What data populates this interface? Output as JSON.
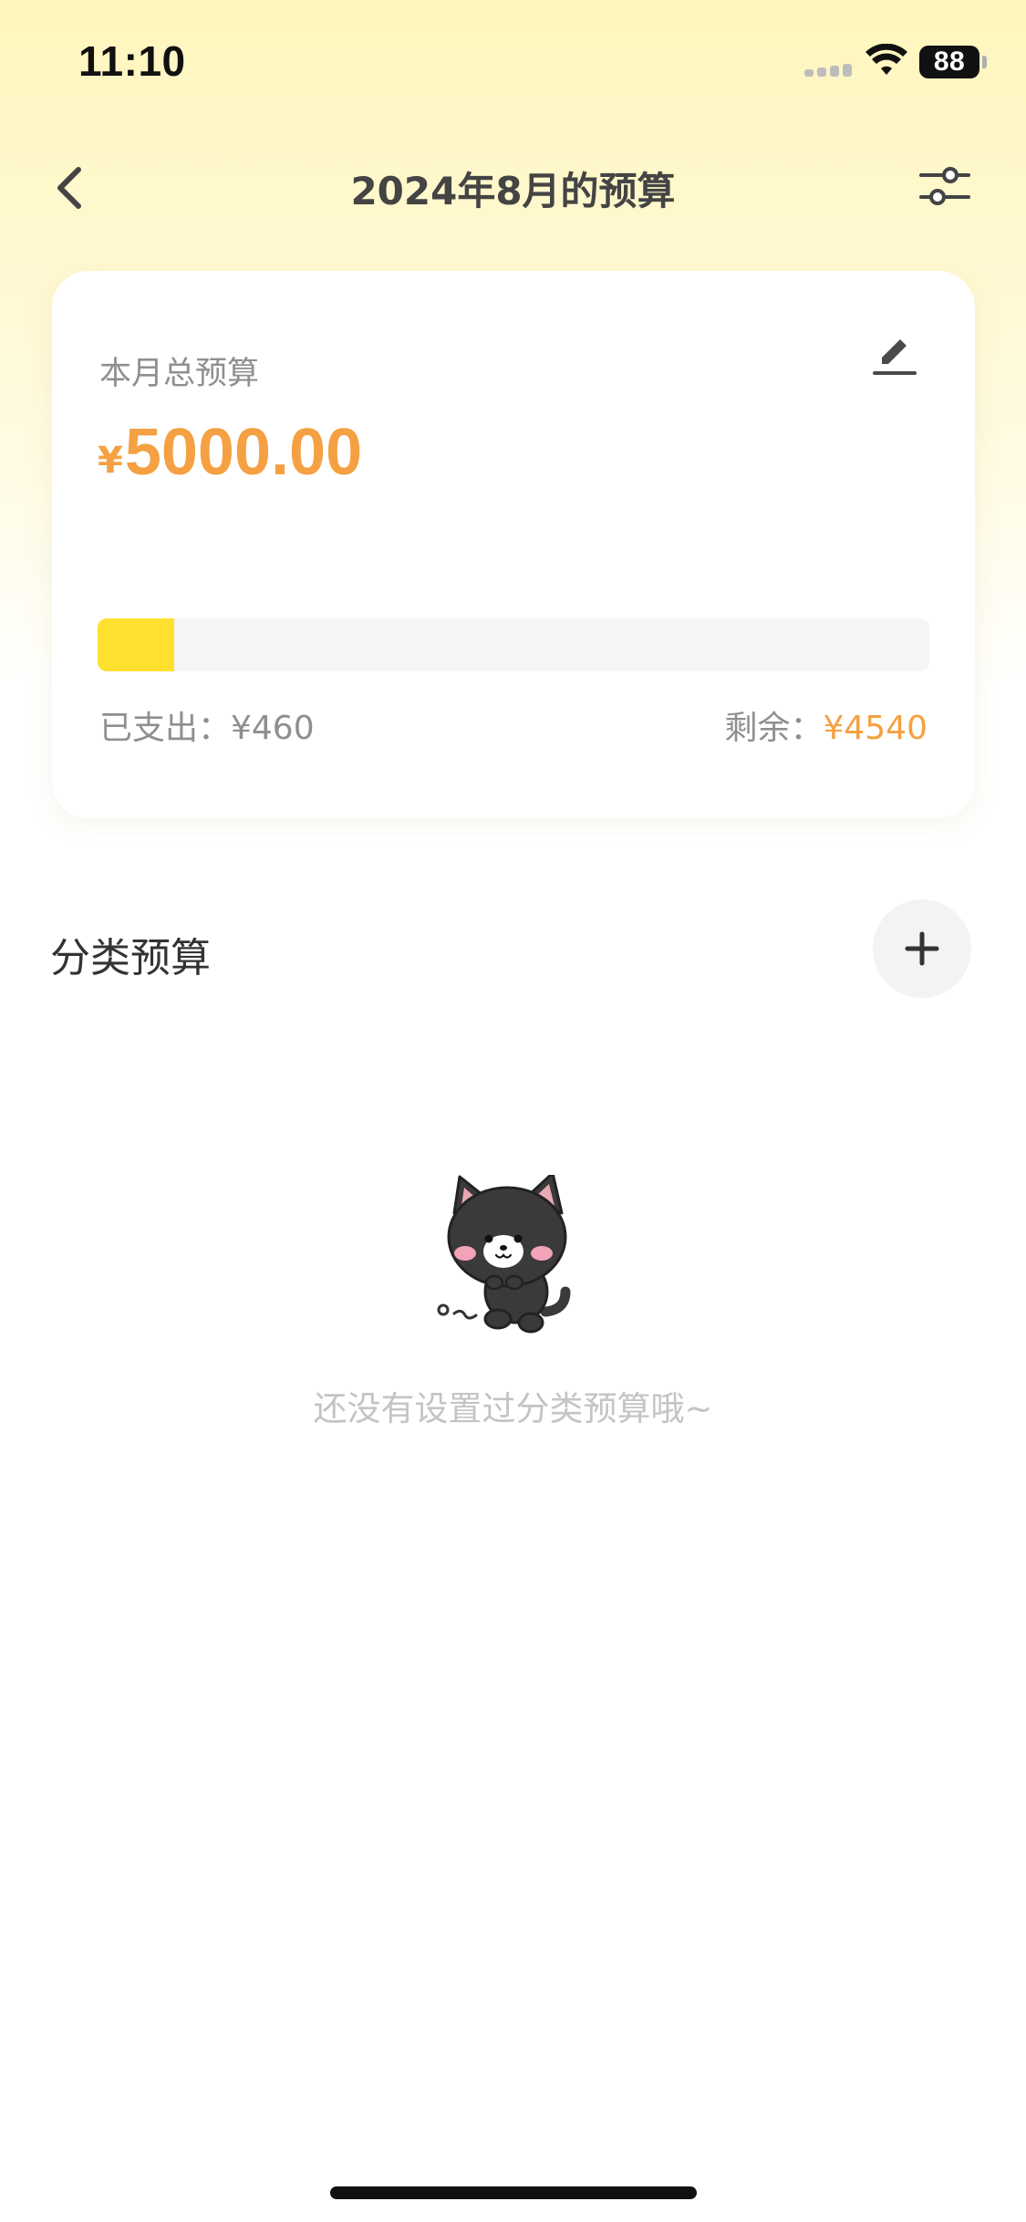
{
  "status_bar": {
    "time": "11:10",
    "battery": "88"
  },
  "nav": {
    "title": "2024年8月的预算",
    "back_icon": "chevron-left-icon",
    "filter_icon": "sliders-icon"
  },
  "budget_card": {
    "label": "本月总预算",
    "currency": "¥",
    "amount": "5000.00",
    "edit_icon": "pencil-icon",
    "progress_fraction": 0.092,
    "progress_color": "#FFE02F",
    "spent_label": "已支出：¥460",
    "remaining_label": "剩余：",
    "remaining_value": "¥4540"
  },
  "category_section": {
    "title": "分类预算",
    "add_icon": "plus-icon",
    "empty_image": "black-cat-illustration",
    "empty_text": "还没有设置过分类预算哦~"
  },
  "colors": {
    "accent": "#F5A042",
    "header_gradient_top": "#FFF6BD"
  }
}
